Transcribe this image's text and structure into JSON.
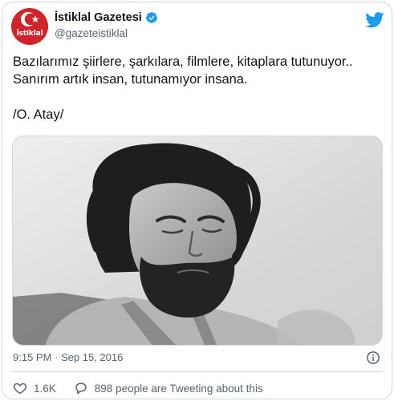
{
  "account": {
    "display_name": "İstiklal Gazetesi",
    "handle": "@gazeteistiklal",
    "avatar_text": "İstiklal",
    "verified_icon": "verified-badge-icon"
  },
  "tweet": {
    "lines": [
      "Bazılarımız şiirlere, şarkılara, filmlere, kitaplara tutunuyor..",
      "Sanırım artık insan, tutunamıyor insana.",
      "/O. Atay/"
    ]
  },
  "media": {
    "description_icon": "photo"
  },
  "meta": {
    "time": "9:15 PM",
    "separator": " · ",
    "date": "Sep 15, 2016"
  },
  "actions": {
    "likes": "1.6K",
    "discussion": "898 people are Tweeting about this"
  },
  "colors": {
    "brand_red": "#d0242b",
    "twitter_blue": "#1d9bf0",
    "muted": "#536471"
  }
}
